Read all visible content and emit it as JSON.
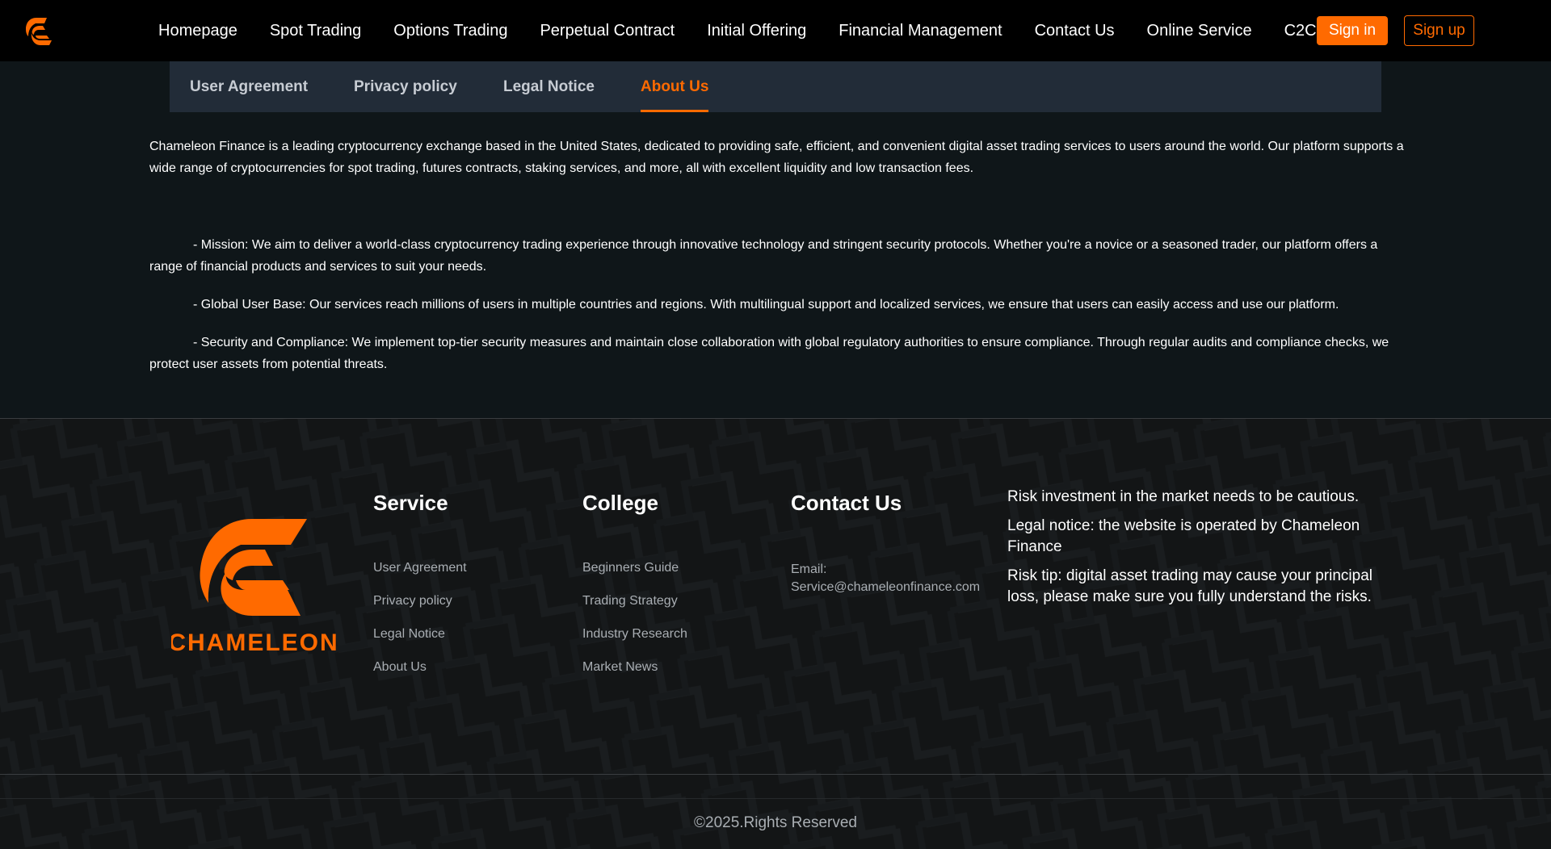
{
  "brand": {
    "logo_icon": "chameleon-logo-icon",
    "footer_logo_text": "CHAMELEON",
    "accent_color": "#ff6a00"
  },
  "nav": {
    "links": [
      "Homepage",
      "Spot Trading",
      "Options Trading",
      "Perpetual Contract",
      "Initial Offering",
      "Financial Management",
      "Contact Us",
      "Online Service",
      "C2C"
    ],
    "sign_in": "Sign in",
    "sign_up": "Sign up"
  },
  "tabs": {
    "items": [
      "User Agreement",
      "Privacy policy",
      "Legal Notice",
      "About Us"
    ],
    "active": "About Us"
  },
  "content": {
    "intro": "Chameleon Finance is a leading cryptocurrency exchange based in the United States, dedicated to providing safe, efficient, and convenient digital asset trading services to users around the world. Our platform supports a wide range of cryptocurrencies for spot trading, futures contracts, staking services, and more, all with excellent liquidity and low transaction fees.",
    "points": [
      "- Mission: We aim to deliver a world-class cryptocurrency trading experience through innovative technology and stringent security protocols. Whether you're a novice or a seasoned trader, our platform offers a range of financial products and services to suit your needs.",
      "- Global User Base: Our services reach millions of users in multiple countries and regions. With multilingual support and localized services, we ensure that users can easily access and use our platform.",
      "- Security and Compliance: We implement top-tier security measures and maintain close collaboration with global regulatory authorities to ensure compliance. Through regular audits and compliance checks, we protect user assets from potential threats."
    ]
  },
  "footer": {
    "service": {
      "title": "Service",
      "links": [
        "User Agreement",
        "Privacy policy",
        "Legal Notice",
        "About Us"
      ]
    },
    "college": {
      "title": "College",
      "links": [
        "Beginners Guide",
        "Trading Strategy",
        "Industry Research",
        "Market News"
      ]
    },
    "contact": {
      "title": "Contact Us",
      "email_label": "Email:",
      "email": "Service@chameleonfinance.com"
    },
    "risk": [
      "Risk investment in the market needs to be cautious.",
      "Legal notice: the website is operated by Chameleon Finance",
      "Risk tip: digital asset trading may cause your principal loss, please make sure you fully understand the risks."
    ],
    "copyright": "©2025.Rights Reserved"
  }
}
